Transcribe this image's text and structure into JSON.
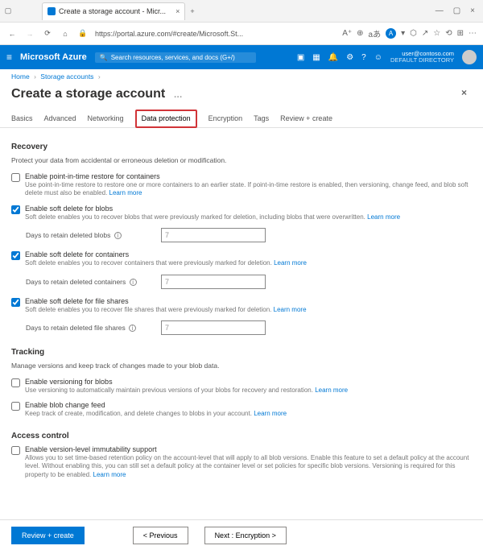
{
  "browser": {
    "tab_title": "Create a storage account - Micr...",
    "url": "https://portal.azure.com/#create/Microsoft.St..."
  },
  "azure_header": {
    "brand": "Microsoft Azure",
    "search_placeholder": "Search resources, services, and docs (G+/)",
    "user_email": "user@contoso.com",
    "user_tenant": "DEFAULT DIRECTORY"
  },
  "breadcrumb": {
    "home": "Home",
    "storage_accounts": "Storage accounts"
  },
  "page": {
    "title": "Create a storage account"
  },
  "tabs": {
    "basics": "Basics",
    "advanced": "Advanced",
    "networking": "Networking",
    "data_protection": "Data protection",
    "encryption": "Encryption",
    "tags": "Tags",
    "review": "Review + create"
  },
  "recovery": {
    "heading": "Recovery",
    "intro": "Protect your data from accidental or erroneous deletion or modification.",
    "pitr": {
      "label": "Enable point-in-time restore for containers",
      "desc": "Use point-in-time restore to restore one or more containers to an earlier state. If point-in-time restore is enabled, then versioning, change feed, and blob soft delete must also be enabled.",
      "learn": "Learn more",
      "checked": false
    },
    "soft_blobs": {
      "label": "Enable soft delete for blobs",
      "desc": "Soft delete enables you to recover blobs that were previously marked for deletion, including blobs that were overwritten.",
      "learn": "Learn more",
      "checked": true,
      "days_label": "Days to retain deleted blobs",
      "days_value": "7"
    },
    "soft_containers": {
      "label": "Enable soft delete for containers",
      "desc": "Soft delete enables you to recover containers that were previously marked for deletion.",
      "learn": "Learn more",
      "checked": true,
      "days_label": "Days to retain deleted containers",
      "days_value": "7"
    },
    "soft_files": {
      "label": "Enable soft delete for file shares",
      "desc": "Soft delete enables you to recover file shares that were previously marked for deletion.",
      "learn": "Learn more",
      "checked": true,
      "days_label": "Days to retain deleted file shares",
      "days_value": "7"
    }
  },
  "tracking": {
    "heading": "Tracking",
    "intro": "Manage versions and keep track of changes made to your blob data.",
    "versioning": {
      "label": "Enable versioning for blobs",
      "desc": "Use versioning to automatically maintain previous versions of your blobs for recovery and restoration.",
      "learn": "Learn more",
      "checked": false
    },
    "change_feed": {
      "label": "Enable blob change feed",
      "desc": "Keep track of create, modification, and delete changes to blobs in your account.",
      "learn": "Learn more",
      "checked": false
    }
  },
  "access_control": {
    "heading": "Access control",
    "immutability": {
      "label": "Enable version-level immutability support",
      "desc": "Allows you to set time-based retention policy on the account-level that will apply to all blob versions. Enable this feature to set a default policy at the account level. Without enabling this, you can still set a default policy at the container level or set policies for specific blob versions. Versioning is required for this property to be enabled.",
      "learn": "Learn more",
      "checked": false
    }
  },
  "footer": {
    "review": "Review + create",
    "previous": "< Previous",
    "next": "Next : Encryption >"
  }
}
